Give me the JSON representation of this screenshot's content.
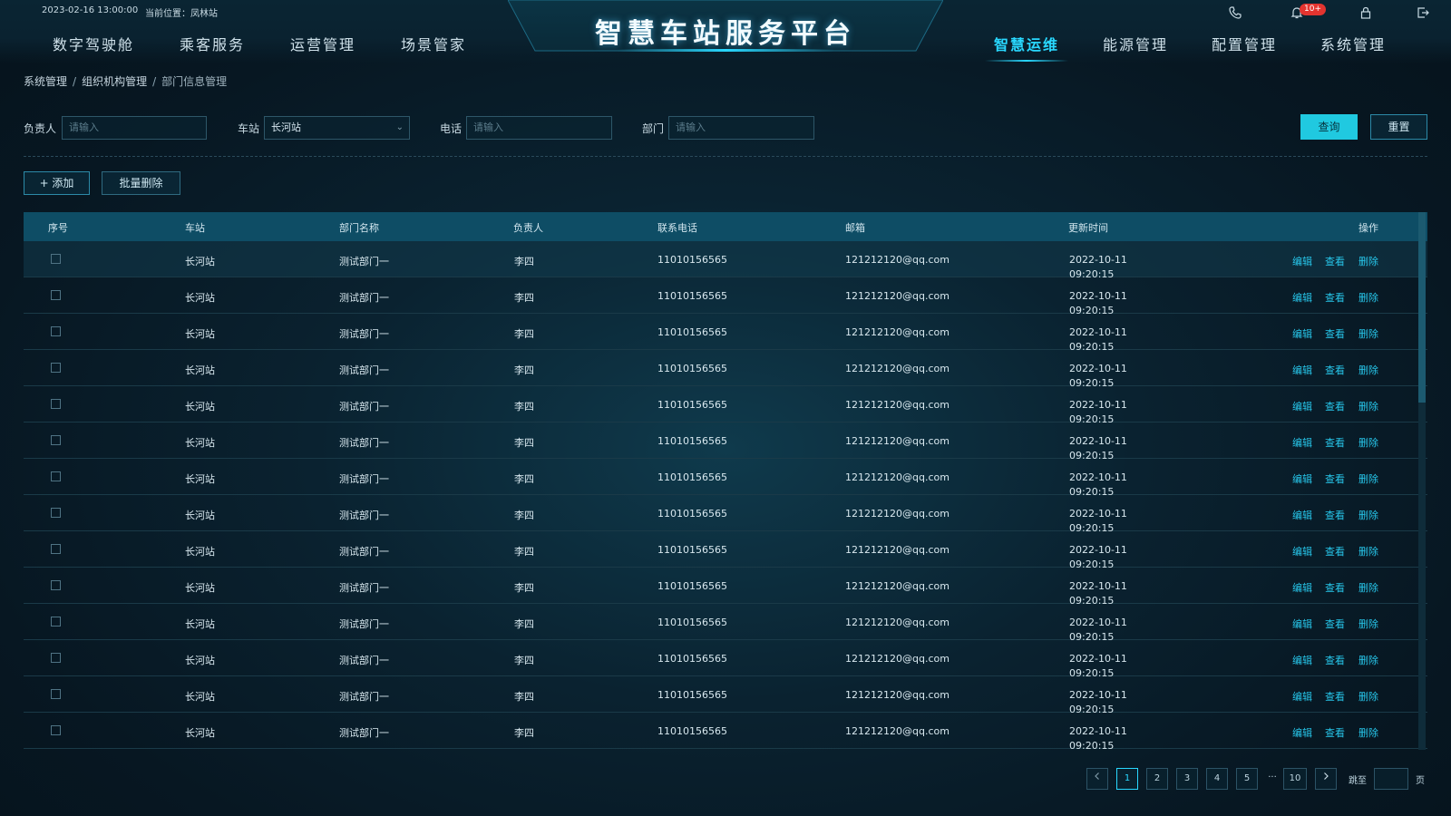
{
  "header": {
    "datetime": "2023-02-16 13:00:00",
    "location": "当前位置：凤林站",
    "title": "智慧车站服务平台",
    "nav_left": [
      "数字驾驶舱",
      "乘客服务",
      "运营管理",
      "场景管家"
    ],
    "nav_right": [
      "智慧运维",
      "能源管理",
      "配置管理",
      "系统管理"
    ],
    "active_nav": "智慧运维",
    "notification_badge": "10+",
    "icons": [
      "phone-icon",
      "bell-icon",
      "lock-icon",
      "logout-icon"
    ]
  },
  "breadcrumb": [
    "系统管理",
    "组织机构管理",
    "部门信息管理"
  ],
  "filters": {
    "manager_label": "负责人",
    "manager_placeholder": "请输入",
    "station_label": "车站",
    "station_value": "长河站",
    "phone_label": "电话",
    "phone_placeholder": "请输入",
    "dept_label": "部门",
    "dept_placeholder": "请输入",
    "query_label": "查询",
    "reset_label": "重置"
  },
  "actions": {
    "add_label": "+ 添加",
    "batch_delete_label": "批量删除"
  },
  "table": {
    "columns": [
      "序号",
      "车站",
      "部门名称",
      "负责人",
      "联系电话",
      "邮箱",
      "更新时间",
      "操作"
    ],
    "rows": [
      {
        "station": "长河站",
        "dept": "测试部门一",
        "manager": "李四",
        "phone": "11010156565",
        "email": "121212120@qq.com",
        "date": "2022-10-11",
        "time": "09:20:15"
      },
      {
        "station": "长河站",
        "dept": "测试部门一",
        "manager": "李四",
        "phone": "11010156565",
        "email": "121212120@qq.com",
        "date": "2022-10-11",
        "time": "09:20:15"
      },
      {
        "station": "长河站",
        "dept": "测试部门一",
        "manager": "李四",
        "phone": "11010156565",
        "email": "121212120@qq.com",
        "date": "2022-10-11",
        "time": "09:20:15"
      },
      {
        "station": "长河站",
        "dept": "测试部门一",
        "manager": "李四",
        "phone": "11010156565",
        "email": "121212120@qq.com",
        "date": "2022-10-11",
        "time": "09:20:15"
      },
      {
        "station": "长河站",
        "dept": "测试部门一",
        "manager": "李四",
        "phone": "11010156565",
        "email": "121212120@qq.com",
        "date": "2022-10-11",
        "time": "09:20:15"
      },
      {
        "station": "长河站",
        "dept": "测试部门一",
        "manager": "李四",
        "phone": "11010156565",
        "email": "121212120@qq.com",
        "date": "2022-10-11",
        "time": "09:20:15"
      },
      {
        "station": "长河站",
        "dept": "测试部门一",
        "manager": "李四",
        "phone": "11010156565",
        "email": "121212120@qq.com",
        "date": "2022-10-11",
        "time": "09:20:15"
      },
      {
        "station": "长河站",
        "dept": "测试部门一",
        "manager": "李四",
        "phone": "11010156565",
        "email": "121212120@qq.com",
        "date": "2022-10-11",
        "time": "09:20:15"
      },
      {
        "station": "长河站",
        "dept": "测试部门一",
        "manager": "李四",
        "phone": "11010156565",
        "email": "121212120@qq.com",
        "date": "2022-10-11",
        "time": "09:20:15"
      },
      {
        "station": "长河站",
        "dept": "测试部门一",
        "manager": "李四",
        "phone": "11010156565",
        "email": "121212120@qq.com",
        "date": "2022-10-11",
        "time": "09:20:15"
      },
      {
        "station": "长河站",
        "dept": "测试部门一",
        "manager": "李四",
        "phone": "11010156565",
        "email": "121212120@qq.com",
        "date": "2022-10-11",
        "time": "09:20:15"
      },
      {
        "station": "长河站",
        "dept": "测试部门一",
        "manager": "李四",
        "phone": "11010156565",
        "email": "121212120@qq.com",
        "date": "2022-10-11",
        "time": "09:20:15"
      },
      {
        "station": "长河站",
        "dept": "测试部门一",
        "manager": "李四",
        "phone": "11010156565",
        "email": "121212120@qq.com",
        "date": "2022-10-11",
        "time": "09:20:15"
      },
      {
        "station": "长河站",
        "dept": "测试部门一",
        "manager": "李四",
        "phone": "11010156565",
        "email": "121212120@qq.com",
        "date": "2022-10-11",
        "time": "09:20:15"
      }
    ],
    "ops": [
      "编辑",
      "查看",
      "删除"
    ]
  },
  "pagination": {
    "pages": [
      "1",
      "2",
      "3",
      "4",
      "5"
    ],
    "ellipsis": "···",
    "last": "10",
    "current": "1",
    "jump_label": "跳至",
    "page_label": "页"
  },
  "colors": {
    "accent": "#29d8ff",
    "primary_button": "#20c9e0",
    "link": "#27c6ea",
    "badge": "#e3342f"
  }
}
